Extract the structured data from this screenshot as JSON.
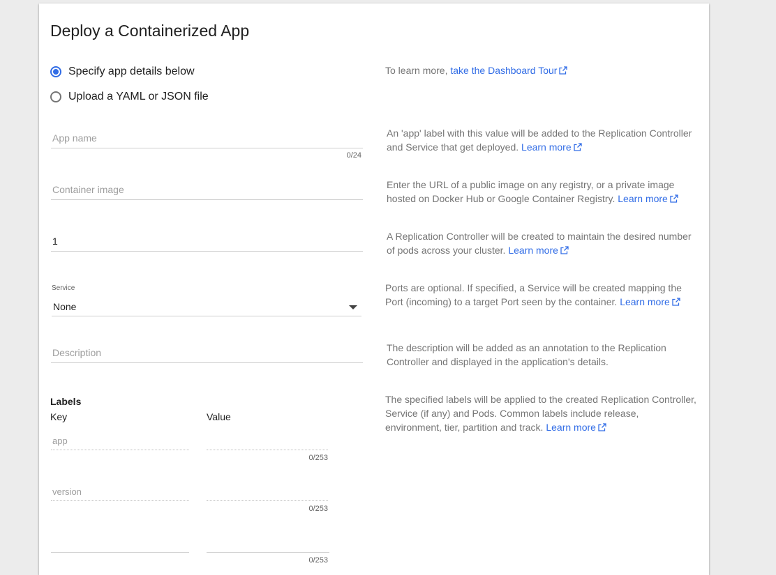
{
  "page": {
    "title": "Deploy a Containerized App"
  },
  "mode": {
    "options": [
      {
        "label": "Specify app details below",
        "checked": true
      },
      {
        "label": "Upload a YAML or JSON file",
        "checked": false
      }
    ]
  },
  "tour": {
    "prefix": "To learn more, ",
    "link": "take the Dashboard Tour"
  },
  "fields": {
    "app_name": {
      "placeholder": "App name",
      "value": "",
      "counter": "0/24"
    },
    "container_image": {
      "placeholder": "Container image",
      "value": ""
    },
    "pods": {
      "value": "1"
    },
    "service": {
      "label": "Service",
      "value": "None"
    },
    "description": {
      "placeholder": "Description",
      "value": ""
    }
  },
  "help": {
    "app_name": {
      "text": "An 'app' label with this value will be added to the Replication Controller and Service that get deployed. ",
      "link": "Learn more"
    },
    "container_image": {
      "text": "Enter the URL of a public image on any registry, or a private image hosted on Docker Hub or Google Container Registry. ",
      "link": "Learn more"
    },
    "pods": {
      "text": "A Replication Controller will be created to maintain the desired number of pods across your cluster. ",
      "link": "Learn more"
    },
    "service": {
      "text": "Ports are optional. If specified, a Service will be created mapping the Port (incoming) to a target Port seen by the container. ",
      "link": "Learn more"
    },
    "description": {
      "text": "The description will be added as an annotation to the Replication Controller and displayed in the application's details."
    },
    "labels": {
      "text": "The specified labels will be applied to the created Replication Controller, Service (if any) and Pods. Common labels include release, environment, tier, partition and track. ",
      "link": "Learn more"
    }
  },
  "labels": {
    "title": "Labels",
    "key_header": "Key",
    "value_header": "Value",
    "rows": [
      {
        "key_placeholder": "app",
        "value": "",
        "counter": "0/253"
      },
      {
        "key_placeholder": "version",
        "value": "",
        "counter": "0/253"
      },
      {
        "key_placeholder": "",
        "value": "",
        "counter": "0/253"
      }
    ]
  },
  "icons": {
    "external_link": "external-link-icon",
    "dropdown": "chevron-down-icon"
  },
  "colors": {
    "accent": "#326de6",
    "help_text": "#757575",
    "text": "#212121"
  }
}
